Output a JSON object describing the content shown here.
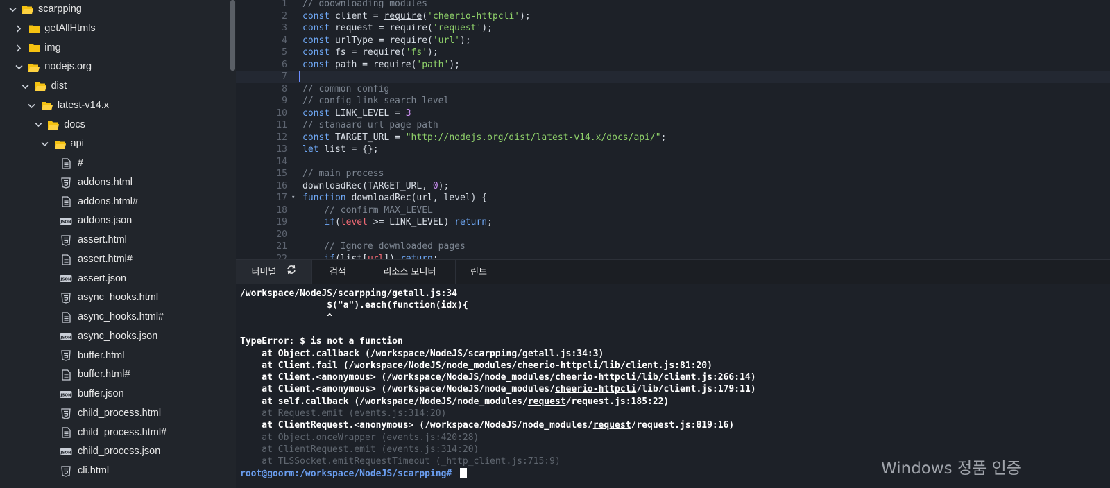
{
  "sidebar": {
    "tree": [
      {
        "label": "scarpping",
        "type": "folder",
        "state": "open",
        "depth": 0
      },
      {
        "label": "getAllHtmls",
        "type": "folder",
        "state": "closed",
        "depth": 1
      },
      {
        "label": "img",
        "type": "folder",
        "state": "closed",
        "depth": 1
      },
      {
        "label": "nodejs.org",
        "type": "folder",
        "state": "open",
        "depth": 1
      },
      {
        "label": "dist",
        "type": "folder",
        "state": "open",
        "depth": 2
      },
      {
        "label": "latest-v14.x",
        "type": "folder",
        "state": "open",
        "depth": 3
      },
      {
        "label": "docs",
        "type": "folder",
        "state": "open",
        "depth": 4
      },
      {
        "label": "api",
        "type": "folder",
        "state": "open",
        "depth": 5
      },
      {
        "label": "#",
        "type": "file",
        "icon": "file-text-icon",
        "depth": 6
      },
      {
        "label": "addons.html",
        "type": "file",
        "icon": "html5-icon",
        "depth": 6
      },
      {
        "label": "addons.html#",
        "type": "file",
        "icon": "file-text-icon",
        "depth": 6
      },
      {
        "label": "addons.json",
        "type": "file",
        "icon": "json-icon",
        "depth": 6
      },
      {
        "label": "assert.html",
        "type": "file",
        "icon": "html5-icon",
        "depth": 6
      },
      {
        "label": "assert.html#",
        "type": "file",
        "icon": "file-text-icon",
        "depth": 6
      },
      {
        "label": "assert.json",
        "type": "file",
        "icon": "json-icon",
        "depth": 6
      },
      {
        "label": "async_hooks.html",
        "type": "file",
        "icon": "html5-icon",
        "depth": 6
      },
      {
        "label": "async_hooks.html#",
        "type": "file",
        "icon": "file-text-icon",
        "depth": 6
      },
      {
        "label": "async_hooks.json",
        "type": "file",
        "icon": "json-icon",
        "depth": 6
      },
      {
        "label": "buffer.html",
        "type": "file",
        "icon": "html5-icon",
        "depth": 6
      },
      {
        "label": "buffer.html#",
        "type": "file",
        "icon": "file-text-icon",
        "depth": 6
      },
      {
        "label": "buffer.json",
        "type": "file",
        "icon": "json-icon",
        "depth": 6
      },
      {
        "label": "child_process.html",
        "type": "file",
        "icon": "html5-icon",
        "depth": 6
      },
      {
        "label": "child_process.html#",
        "type": "file",
        "icon": "file-text-icon",
        "depth": 6
      },
      {
        "label": "child_process.json",
        "type": "file",
        "icon": "json-icon",
        "depth": 6
      },
      {
        "label": "cli.html",
        "type": "file",
        "icon": "html5-icon",
        "depth": 6
      }
    ],
    "json_badge": "JSON"
  },
  "editor": {
    "current_line": 7,
    "lines": [
      {
        "n": "1",
        "tokens": [
          [
            "cm",
            "// doownloading modules"
          ]
        ]
      },
      {
        "n": "2",
        "tokens": [
          [
            "kw",
            "const "
          ],
          [
            "fn",
            "client = "
          ],
          [
            "ul",
            "require"
          ],
          [
            "fn",
            "("
          ],
          [
            "st",
            "'cheerio-httpcli'"
          ],
          [
            "fn",
            ");"
          ]
        ]
      },
      {
        "n": "3",
        "tokens": [
          [
            "kw",
            "const "
          ],
          [
            "fn",
            "request = require("
          ],
          [
            "st",
            "'request'"
          ],
          [
            "fn",
            ");"
          ]
        ]
      },
      {
        "n": "4",
        "tokens": [
          [
            "kw",
            "const "
          ],
          [
            "fn",
            "urlType = require("
          ],
          [
            "st",
            "'url'"
          ],
          [
            "fn",
            ");"
          ]
        ]
      },
      {
        "n": "5",
        "tokens": [
          [
            "kw",
            "const "
          ],
          [
            "fn",
            "fs = require("
          ],
          [
            "st",
            "'fs'"
          ],
          [
            "fn",
            ");"
          ]
        ]
      },
      {
        "n": "6",
        "tokens": [
          [
            "kw",
            "const "
          ],
          [
            "fn",
            "path = require("
          ],
          [
            "st",
            "'path'"
          ],
          [
            "fn",
            ");"
          ]
        ]
      },
      {
        "n": "7",
        "tokens": []
      },
      {
        "n": "8",
        "tokens": [
          [
            "cm",
            "// common config"
          ]
        ]
      },
      {
        "n": "9",
        "tokens": [
          [
            "cm",
            "// config link search level"
          ]
        ]
      },
      {
        "n": "10",
        "tokens": [
          [
            "kw",
            "const "
          ],
          [
            "fn",
            "LINK_LEVEL = "
          ],
          [
            "nm",
            "3"
          ]
        ]
      },
      {
        "n": "11",
        "tokens": [
          [
            "cm",
            "// stanaard url page path"
          ]
        ]
      },
      {
        "n": "12",
        "tokens": [
          [
            "kw",
            "const "
          ],
          [
            "fn",
            "TARGET_URL = "
          ],
          [
            "st",
            "\"http://nodejs.org/dist/latest-v14.x/docs/api/\""
          ],
          [
            "fn",
            ";"
          ]
        ]
      },
      {
        "n": "13",
        "tokens": [
          [
            "kw",
            "let "
          ],
          [
            "fn",
            "list = {};"
          ]
        ]
      },
      {
        "n": "14",
        "tokens": []
      },
      {
        "n": "15",
        "tokens": [
          [
            "cm",
            "// main process"
          ]
        ]
      },
      {
        "n": "16",
        "tokens": [
          [
            "fn",
            "downloadRec(TARGET_URL, "
          ],
          [
            "nm",
            "0"
          ],
          [
            "fn",
            ");"
          ]
        ]
      },
      {
        "n": "17",
        "fold": true,
        "tokens": [
          [
            "kw",
            "function "
          ],
          [
            "fn",
            "downloadRec(url, level) {"
          ]
        ]
      },
      {
        "n": "18",
        "tokens": [
          [
            "fn",
            "    "
          ],
          [
            "cm",
            "// confirm MAX_LEVEL"
          ]
        ]
      },
      {
        "n": "19",
        "tokens": [
          [
            "fn",
            "    "
          ],
          [
            "kw",
            "if"
          ],
          [
            "fn",
            "("
          ],
          [
            "rd",
            "level"
          ],
          [
            "fn",
            " >= LINK_LEVEL) "
          ],
          [
            "kw",
            "return"
          ],
          [
            "fn",
            ";"
          ]
        ]
      },
      {
        "n": "20",
        "tokens": []
      },
      {
        "n": "21",
        "tokens": [
          [
            "fn",
            "    "
          ],
          [
            "cm",
            "// Ignore downloaded pages"
          ]
        ]
      },
      {
        "n": "22",
        "tokens": [
          [
            "fn",
            "    "
          ],
          [
            "kw",
            "if"
          ],
          [
            "fn",
            "(list["
          ],
          [
            "rd",
            "url"
          ],
          [
            "fn",
            "]) "
          ],
          [
            "kw",
            "return"
          ],
          [
            "fn",
            ";"
          ]
        ]
      }
    ]
  },
  "panel_tabs": [
    {
      "label": "터미널",
      "active": true,
      "icon": "refresh-icon"
    },
    {
      "label": "검색",
      "active": false
    },
    {
      "label": "리소스 모니터",
      "active": false
    },
    {
      "label": "린트",
      "active": false
    }
  ],
  "terminal": {
    "lines": [
      {
        "style": "normal",
        "parts": [
          [
            "",
            "/workspace/NodeJS/scarpping/getall.js:34"
          ]
        ]
      },
      {
        "style": "normal",
        "parts": [
          [
            "",
            "                $(\"a\").each(function(idx){"
          ]
        ]
      },
      {
        "style": "normal",
        "parts": [
          [
            "",
            "                ^"
          ]
        ]
      },
      {
        "style": "normal",
        "parts": [
          [
            "",
            ""
          ]
        ]
      },
      {
        "style": "normal",
        "parts": [
          [
            "",
            "TypeError: $ is not a function"
          ]
        ]
      },
      {
        "style": "normal",
        "parts": [
          [
            "",
            "    at Object.callback (/workspace/NodeJS/scarpping/getall.js:34:3)"
          ]
        ]
      },
      {
        "style": "normal",
        "parts": [
          [
            "",
            "    at Client.fail (/workspace/NodeJS/node_modules/"
          ],
          [
            "u",
            "cheerio-httpcli"
          ],
          [
            "",
            "/lib/client.js:81:20)"
          ]
        ]
      },
      {
        "style": "normal",
        "parts": [
          [
            "",
            "    at Client.<anonymous> (/workspace/NodeJS/node_modules/"
          ],
          [
            "u",
            "cheerio-httpcli"
          ],
          [
            "",
            "/lib/client.js:266:14)"
          ]
        ]
      },
      {
        "style": "normal",
        "parts": [
          [
            "",
            "    at Client.<anonymous> (/workspace/NodeJS/node_modules/"
          ],
          [
            "u",
            "cheerio-httpcli"
          ],
          [
            "",
            "/lib/client.js:179:11)"
          ]
        ]
      },
      {
        "style": "normal",
        "parts": [
          [
            "",
            "    at self.callback (/workspace/NodeJS/node_modules/"
          ],
          [
            "u",
            "request"
          ],
          [
            "",
            "/request.js:185:22)"
          ]
        ]
      },
      {
        "style": "dim",
        "parts": [
          [
            "",
            "    at Request.emit (events.js:314:20)"
          ]
        ]
      },
      {
        "style": "normal",
        "parts": [
          [
            "",
            "    at ClientRequest.<anonymous> (/workspace/NodeJS/node_modules/"
          ],
          [
            "u",
            "request"
          ],
          [
            "",
            "/request.js:819:16)"
          ]
        ]
      },
      {
        "style": "dim",
        "parts": [
          [
            "",
            "    at Object.onceWrapper (events.js:420:28)"
          ]
        ]
      },
      {
        "style": "dim",
        "parts": [
          [
            "",
            "    at ClientRequest.emit (events.js:314:20)"
          ]
        ]
      },
      {
        "style": "dim",
        "parts": [
          [
            "",
            "    at TLSSocket.emitRequestTimeout (_http_client.js:715:9)"
          ]
        ]
      },
      {
        "style": "prompt",
        "parts": [
          [
            "",
            "root@goorm:/workspace/NodeJS/scarpping# "
          ]
        ],
        "cursor": true
      }
    ]
  },
  "watermark": "Windows 정품 인증",
  "colors": {
    "folder": "#f5c211",
    "keyword": "#6fa8f5",
    "comment": "#7c8591",
    "string": "#8fd16a",
    "number": "#c98ef0",
    "prompt": "#6a9ef0"
  }
}
